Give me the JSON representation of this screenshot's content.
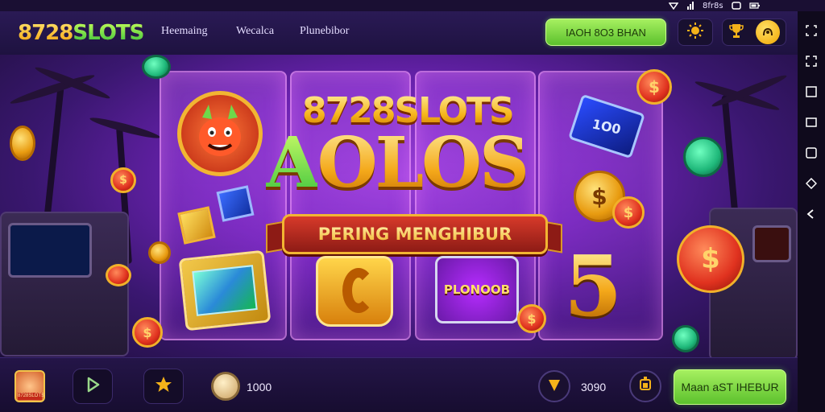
{
  "status_bar": {
    "icons": [
      "wifi-icon",
      "signal-icon",
      "screen-icon",
      "battery-icon"
    ],
    "text": "8fr8s"
  },
  "header": {
    "logo_prefix": "8728",
    "logo_suffix": "SLOTS",
    "nav": [
      "Heemaing",
      "Wecalca",
      "Plunebibor"
    ],
    "main_button": "IAOH 8O3 BHAN",
    "icon_button_a": "sun-icon",
    "icon_button_b": [
      "trophy-icon",
      "user-icon"
    ]
  },
  "banner": {
    "brand": "8728SLOTS",
    "headline_a": "A",
    "headline_b": "OLOS",
    "ribbon": "PERING MENGHIBUR",
    "ticket_label": "1O0",
    "slot_label": "PLONOOB",
    "big_number": "5",
    "coin_symbol": "$"
  },
  "side_toolbar": [
    "expand-icon",
    "fullscreen-icon",
    "menu-icon",
    "window-icon",
    "copy-icon",
    "shape-icon",
    "back-icon"
  ],
  "bottom_bar": {
    "avatar_label": "8728SLOTS",
    "coins_value": "1000",
    "gems_value": "3090",
    "cta_button": "Maan aST IHEBUR"
  },
  "colors": {
    "accent_green": "#7ad846",
    "gold": "#f4b21a",
    "purple_bg": "#6a22b0"
  }
}
